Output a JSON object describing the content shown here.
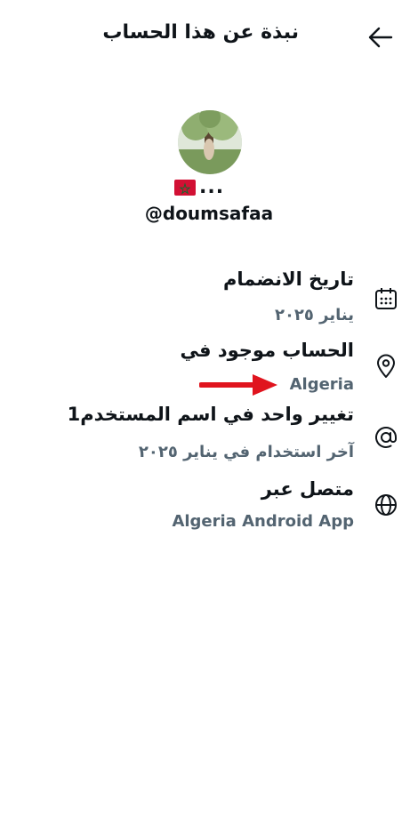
{
  "header": {
    "title": "نبذة عن هذا الحساب",
    "back_icon": "arrow-left-icon"
  },
  "profile": {
    "display_name_suffix": "...",
    "flag_icon": "morocco-flag-icon",
    "handle": "@doumsafaa"
  },
  "details": [
    {
      "icon": "calendar-icon",
      "label": "تاريخ الانضمام",
      "value": "يناير ٢٠٢٥"
    },
    {
      "icon": "location-pin-icon",
      "label": "الحساب موجود في",
      "value": "Algeria"
    },
    {
      "icon": "at-sign-icon",
      "label": "تغيير واحد في اسم المستخدم1",
      "value": "آخر استخدام في يناير ٢٠٢٥"
    },
    {
      "icon": "globe-icon",
      "label": "متصل عبر",
      "value": "Algeria Android App"
    }
  ],
  "annotation": {
    "icon": "red-arrow-icon",
    "color": "#e0141e"
  },
  "colors": {
    "primary_text": "#0f1419",
    "secondary_text": "#536471"
  }
}
